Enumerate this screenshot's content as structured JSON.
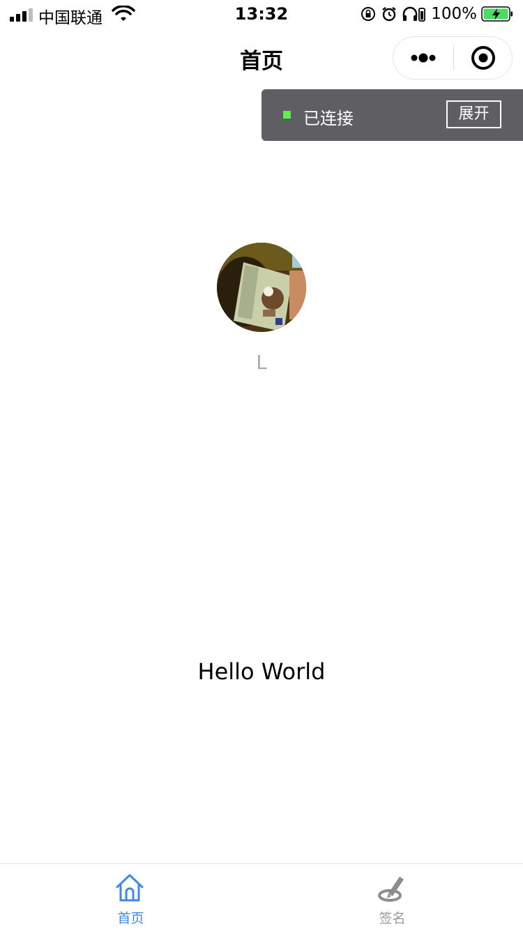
{
  "status_bar": {
    "carrier": "中国联通",
    "time": "13:32",
    "battery": "100%"
  },
  "nav": {
    "title": "首页",
    "capsule": {
      "more_icon": "more-dots-icon",
      "close_icon": "target-close-icon"
    }
  },
  "connection": {
    "status_text": "已连接",
    "expand_label": "展开",
    "status_color": "#60f04c",
    "panel_color": "#5f5f63"
  },
  "profile": {
    "nickname": "L"
  },
  "main": {
    "motto": "Hello World"
  },
  "tabbar": {
    "active_color": "#3d89e4",
    "inactive_color": "#999999",
    "items": [
      {
        "label": "首页",
        "icon": "home-icon",
        "active": true
      },
      {
        "label": "签名",
        "icon": "signature-pen-icon",
        "active": false
      }
    ]
  }
}
